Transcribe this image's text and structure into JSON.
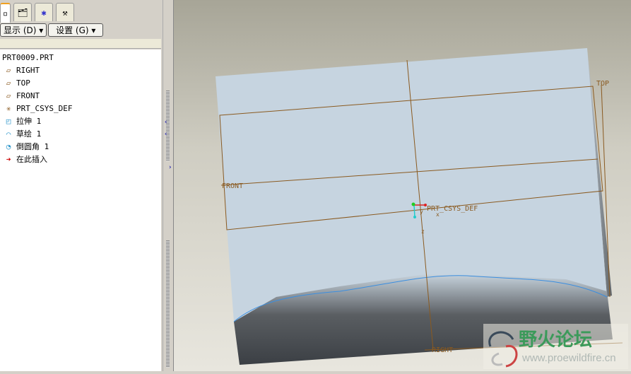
{
  "toolbar": {
    "show_label": "显示 (D) ▾",
    "settings_label": "设置 (G) ▾"
  },
  "tree": {
    "root": "PRT0009.PRT",
    "items": [
      {
        "label": "RIGHT",
        "icon": "datum-plane-icon"
      },
      {
        "label": "TOP",
        "icon": "datum-plane-icon"
      },
      {
        "label": "FRONT",
        "icon": "datum-plane-icon"
      },
      {
        "label": "PRT_CSYS_DEF",
        "icon": "csys-icon"
      },
      {
        "label": "拉伸 1",
        "icon": "extrude-icon"
      },
      {
        "label": "草绘 1",
        "icon": "sketch-icon"
      },
      {
        "label": "倒圆角 1",
        "icon": "round-icon"
      },
      {
        "label": "在此插入",
        "icon": "insert-arrow-icon"
      }
    ]
  },
  "viewport": {
    "labels": {
      "top": "TOP",
      "front": "FRONT",
      "right": "RIGHT",
      "csys": "PRT_CSYS_DEF",
      "x": "x",
      "y": "y",
      "z": "z"
    }
  },
  "watermark": {
    "name": "野火论坛",
    "url": "www.proewildfire.cn"
  }
}
